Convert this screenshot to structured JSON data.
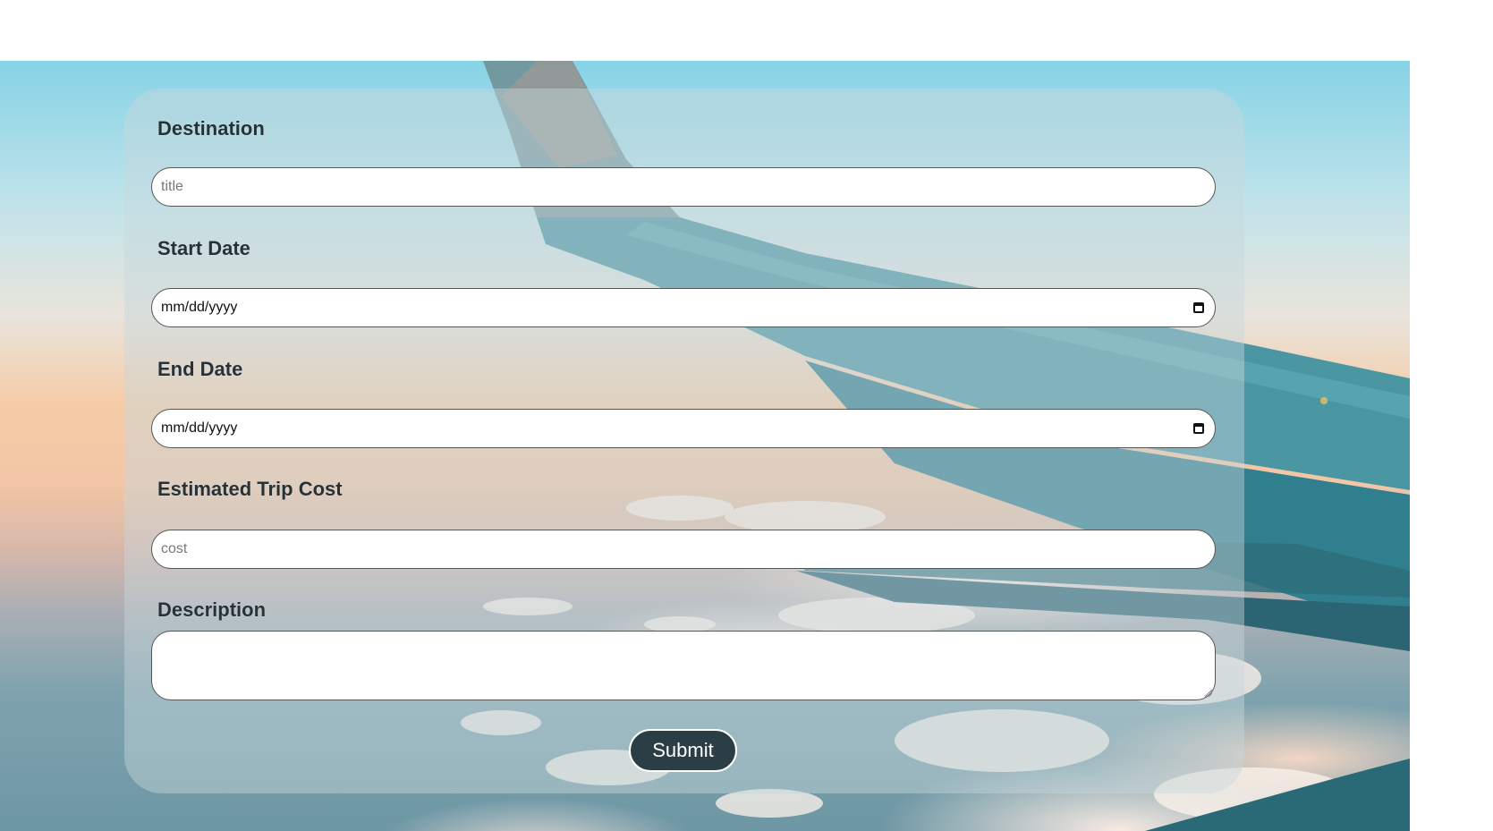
{
  "form": {
    "destination": {
      "label": "Destination",
      "placeholder": "title"
    },
    "start_date": {
      "label": "Start Date",
      "value": "mm/dd/yyyy"
    },
    "end_date": {
      "label": "End Date",
      "value": "mm/dd/yyyy"
    },
    "cost": {
      "label": "Estimated Trip Cost",
      "placeholder": "cost"
    },
    "description": {
      "label": "Description"
    },
    "submit_label": "Submit"
  },
  "colors": {
    "button_bg": "#2c3e45",
    "label_text": "#263238",
    "card_overlay": "rgba(200,215,220,0.45)"
  },
  "icons": [
    "calendar-icon",
    "resize-grip-icon"
  ]
}
